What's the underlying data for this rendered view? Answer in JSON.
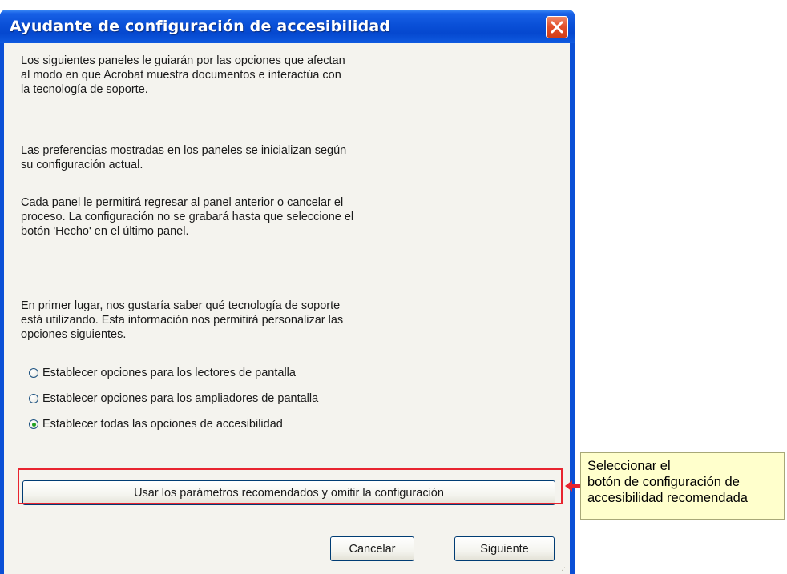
{
  "window": {
    "title": "Ayudante de configuración de accesibilidad",
    "close_icon": "close-icon"
  },
  "intro": {
    "line1": "Los siguientes paneles le guiarán por las opciones que afectan",
    "line2": "al modo en que Acrobat muestra documentos e interactúa con",
    "line3": "la tecnología de soporte."
  },
  "preferences": {
    "line1": "Las preferencias mostradas en los paneles se inicializan según",
    "line2": "su configuración actual."
  },
  "navigation": {
    "line1": "Cada panel le permitirá regresar al panel anterior o cancelar el",
    "line2": "proceso. La configuración no se grabará hasta que seleccione el",
    "line3": "botón 'Hecho' en el último panel."
  },
  "question": {
    "line1": "En primer lugar, nos gustaría saber qué tecnología de soporte",
    "line2": "está utilizando. Esta información nos permitirá personalizar las",
    "line3": "opciones siguientes."
  },
  "options": [
    {
      "label": "Establecer opciones para los lectores de pantalla",
      "selected": false
    },
    {
      "label": "Establecer opciones para los ampliadores de pantalla",
      "selected": false
    },
    {
      "label": "Establecer todas las opciones de accesibilidad",
      "selected": true
    }
  ],
  "buttons": {
    "recommended": "Usar los parámetros recomendados y omitir la configuración",
    "cancel": "Cancelar",
    "next": "Siguiente"
  },
  "callout": {
    "line1": "Seleccionar el",
    "line2": "botón de configuración de",
    "line3": "accesibilidad recomendada"
  },
  "colors": {
    "title_bar": "#0a4fd6",
    "highlight": "#e8242f",
    "callout_bg": "#ffffcc"
  }
}
